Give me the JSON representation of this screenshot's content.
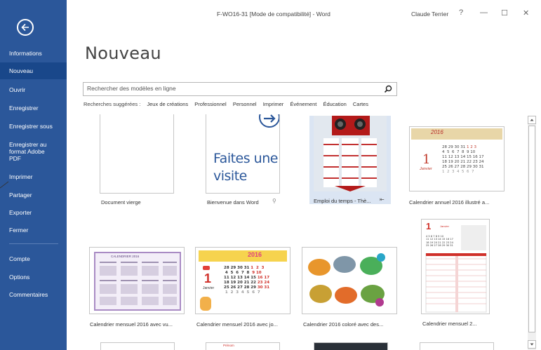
{
  "window": {
    "title": "F-WO16-31 [Mode de compatibilité] - Word",
    "user": "Claude Terrier",
    "help": "?",
    "minimize": "—",
    "maximize": "☐",
    "close": "✕"
  },
  "sidebar": {
    "items": [
      {
        "label": "Informations"
      },
      {
        "label": "Nouveau"
      },
      {
        "label": "Ouvrir"
      },
      {
        "label": "Enregistrer"
      },
      {
        "label": "Enregistrer sous"
      },
      {
        "label": "Enregistrer au format Adobe PDF"
      },
      {
        "label": "Imprimer"
      },
      {
        "label": "Partager"
      },
      {
        "label": "Exporter"
      },
      {
        "label": "Fermer"
      },
      {
        "label": "Compte"
      },
      {
        "label": "Options"
      },
      {
        "label": "Commentaires"
      }
    ],
    "pdf_lines": [
      "Enregistrer au",
      "format Adobe",
      "PDF"
    ]
  },
  "main": {
    "heading": "Nouveau",
    "search": {
      "placeholder": "Rechercher des modèles en ligne"
    },
    "suggestions_label": "Recherches suggérées :",
    "suggestions": [
      "Jeux de créations",
      "Professionnel",
      "Personnel",
      "Imprimer",
      "Événement",
      "Éducation",
      "Cartes"
    ],
    "templates": [
      {
        "label": "Document vierge"
      },
      {
        "label": "Bienvenue dans Word",
        "thumb_text_1": "Faites une",
        "thumb_text_2": "visite"
      },
      {
        "label": "Emploi du temps - Thè..."
      },
      {
        "label": "Calendrier annuel 2016 illustré a...",
        "year": "2016",
        "month": "Janvier",
        "big_num": "1"
      },
      {
        "label": "Calendrier mensuel 2016 avec vu...",
        "banner": "CALENDRIER 2016"
      },
      {
        "label": "Calendrier mensuel 2016 avec jo...",
        "year": "2016",
        "month": "Janvier",
        "big_num": "1"
      },
      {
        "label": "Calendrier 2016 coloré avec des..."
      },
      {
        "label": "Calendrier mensuel 2...",
        "big_num": "1",
        "month": "Janvier"
      }
    ],
    "row3_hint": "Prénom"
  },
  "colors": {
    "sidebar": "#2b579a",
    "sidebar_active": "#19478a",
    "selected_tile": "#dbe5f3"
  }
}
